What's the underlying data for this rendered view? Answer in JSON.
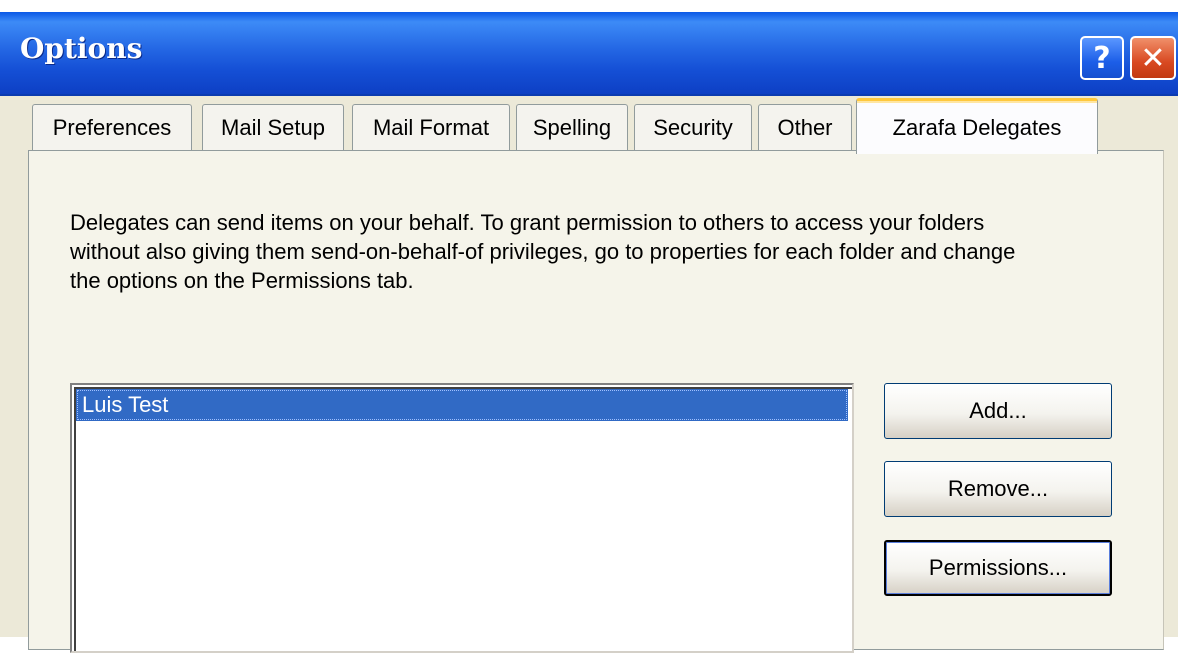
{
  "window": {
    "title": "Options",
    "help_label": "?",
    "close_label": "✕"
  },
  "tabs": [
    {
      "label": "Preferences"
    },
    {
      "label": "Mail Setup"
    },
    {
      "label": "Mail Format"
    },
    {
      "label": "Spelling"
    },
    {
      "label": "Security"
    },
    {
      "label": "Other"
    },
    {
      "label": "Zarafa Delegates",
      "active": true
    }
  ],
  "delegates": {
    "description": "Delegates can send items on your behalf. To grant permission to others to access your folders without also giving them send-on-behalf-of privileges, go to properties for each folder and change the options on the Permissions tab.",
    "list": [
      {
        "name": "Luis Test",
        "selected": true
      }
    ],
    "buttons": {
      "add": "Add...",
      "remove": "Remove...",
      "permissions": "Permissions..."
    }
  },
  "colors": {
    "titlebar": "#2467e4",
    "selection": "#316ac5",
    "active_tab_accent": "#ffc83c",
    "dialog_background": "#ece9d8"
  }
}
